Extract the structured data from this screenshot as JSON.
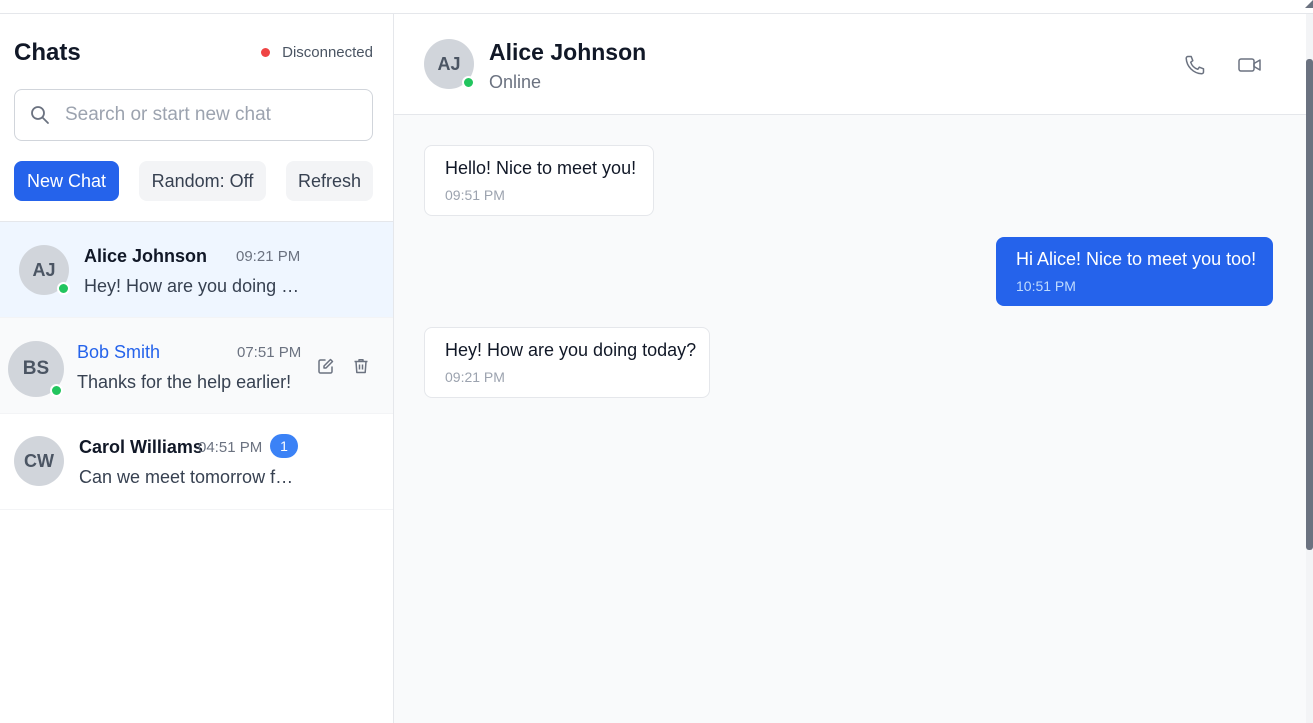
{
  "sidebar": {
    "title": "Chats",
    "connection_status": "Disconnected",
    "search_placeholder": "Search or start new chat",
    "buttons": {
      "new_chat": "New Chat",
      "random": "Random: Off",
      "refresh": "Refresh"
    },
    "chats": [
      {
        "initials": "AJ",
        "name": "Alice Johnson",
        "time": "09:21 PM",
        "preview": "Hey! How are you doing today?",
        "online": true,
        "active": true
      },
      {
        "initials": "BS",
        "name": "Bob Smith",
        "time": "07:51 PM",
        "preview": "Thanks for the help earlier!",
        "online": true,
        "hovered": true
      },
      {
        "initials": "CW",
        "name": "Carol Williams",
        "time": "04:51 PM",
        "preview": "Can we meet tomorrow for lunch?",
        "online": false,
        "unread": "1"
      }
    ]
  },
  "conversation": {
    "contact": {
      "initials": "AJ",
      "name": "Alice Johnson",
      "status": "Online"
    },
    "icons": {
      "call": "phone-icon",
      "video": "video-camera-icon"
    },
    "messages": [
      {
        "text": "Hello! Nice to meet you!",
        "time": "09:51 PM",
        "direction": "incoming"
      },
      {
        "text": "Hi Alice! Nice to meet you too!",
        "time": "10:51 PM",
        "direction": "outgoing"
      },
      {
        "text": "Hey! How are you doing today?",
        "time": "09:21 PM",
        "direction": "incoming"
      }
    ]
  },
  "colors": {
    "accent": "#2563eb",
    "online": "#22c55e",
    "disconnected": "#ef4444",
    "badge": "#3b82f6"
  }
}
